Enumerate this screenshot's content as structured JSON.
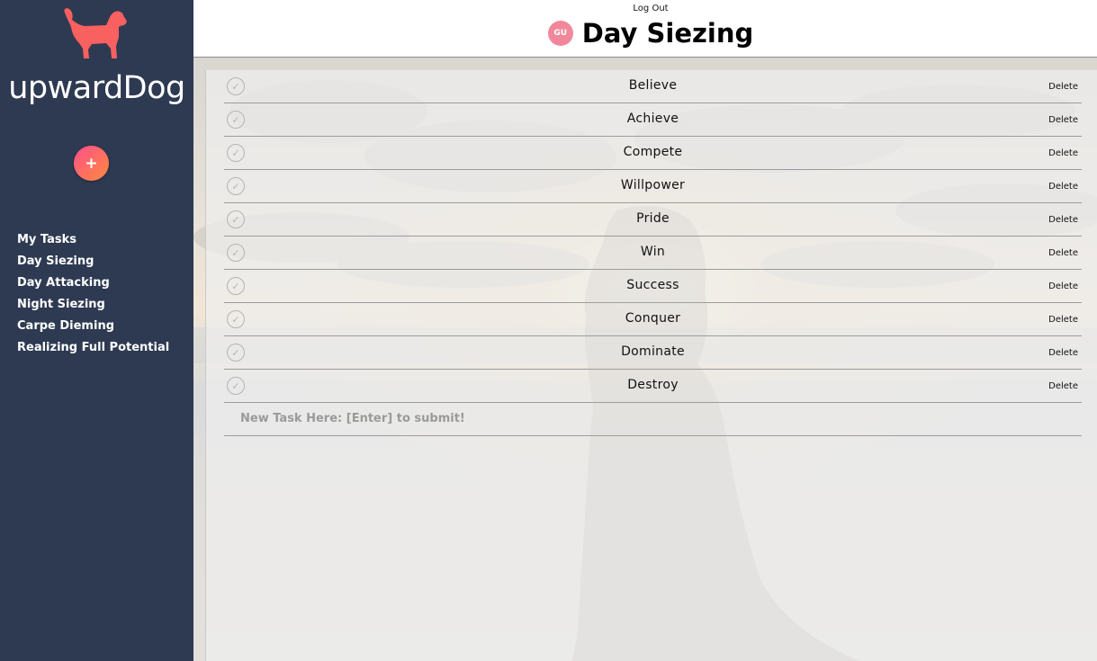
{
  "sidebar": {
    "brand": "upwardDog",
    "add_label": "+",
    "nav": [
      "My Tasks",
      "Day Siezing",
      "Day Attacking",
      "Night Siezing",
      "Carpe Dieming",
      "Realizing Full Potential"
    ]
  },
  "header": {
    "logout": "Log Out",
    "avatar_initials": "GU",
    "title": "Day Siezing"
  },
  "tasks": {
    "delete_label": "Delete",
    "check_glyph": "✓",
    "items": [
      "Believe",
      "Achieve",
      "Compete",
      "Willpower",
      "Pride",
      "Win",
      "Success",
      "Conquer",
      "Dominate",
      "Destroy"
    ],
    "new_task_placeholder": "New Task Here: [Enter] to submit!"
  },
  "colors": {
    "sidebar": "#2e3a52",
    "accent": "#f96060",
    "avatar": "#f2879b"
  },
  "icons": [
    "dog-logo-icon",
    "plus-icon",
    "check-icon"
  ]
}
